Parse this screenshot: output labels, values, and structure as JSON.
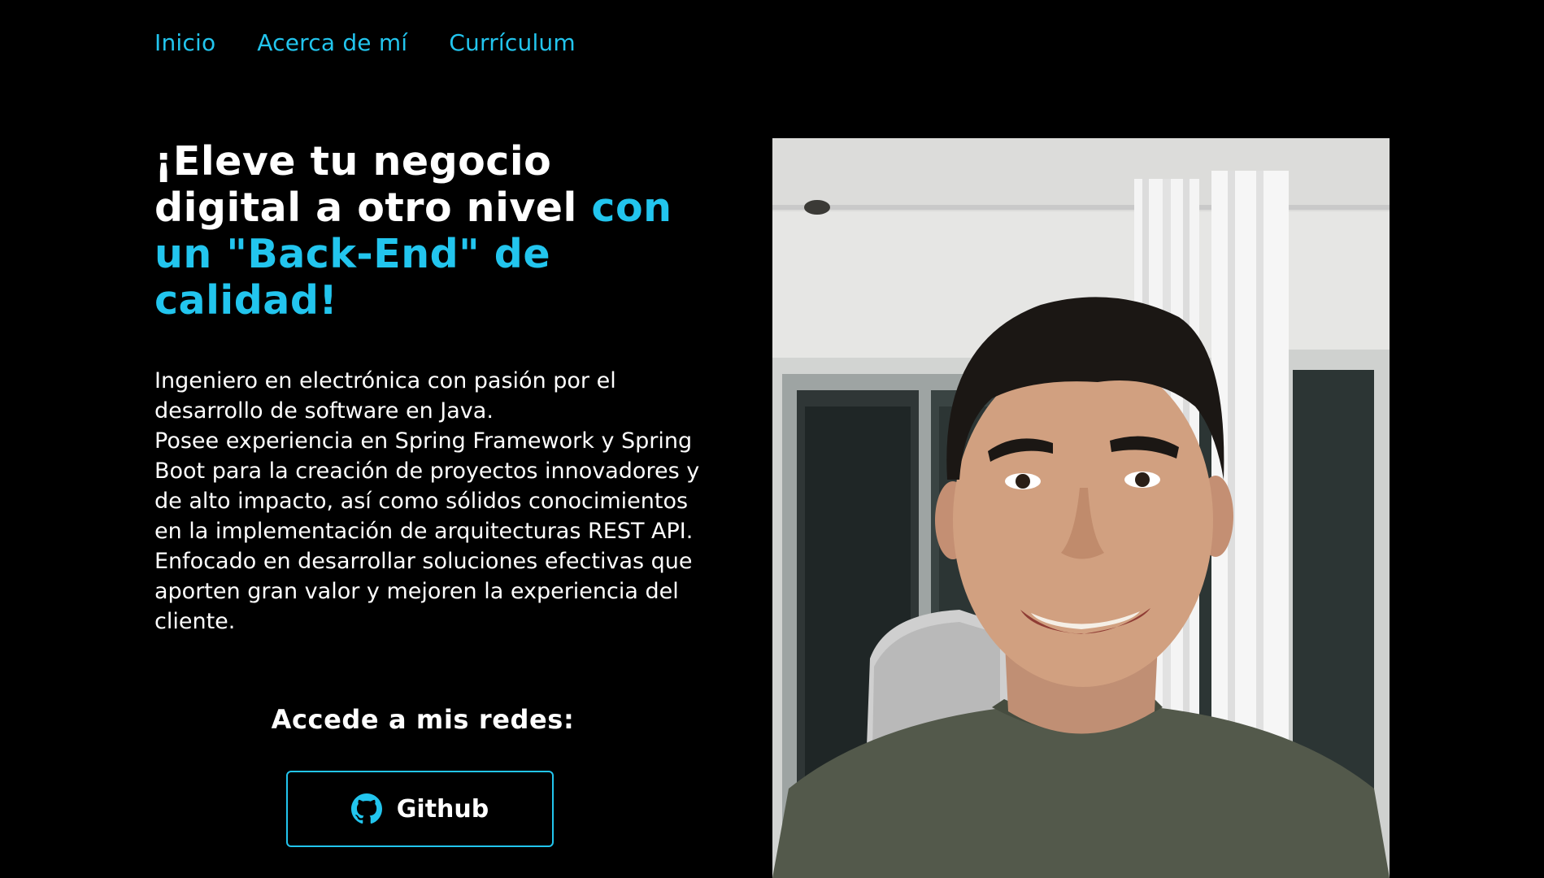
{
  "nav": {
    "items": [
      {
        "label": "Inicio"
      },
      {
        "label": "Acerca de mí"
      },
      {
        "label": "Currículum"
      }
    ]
  },
  "hero": {
    "headline_white": "¡Eleve tu negocio digital a otro nivel",
    "headline_accent": "con un \"Back-End\" de calidad!",
    "bio": [
      "Ingeniero en electrónica con pasión por el desarrollo de software en Java.",
      "Posee experiencia en Spring Framework y Spring Boot para la creación de proyectos innovadores y de alto impacto, así como sólidos conocimientos en la implementación de arquitecturas REST API.",
      "Enfocado en desarrollar soluciones efectivas que aporten gran valor y mejoren la experiencia del cliente."
    ]
  },
  "socials": {
    "title": "Accede a mis redes:",
    "github_label": "Github",
    "github_icon": "github-icon"
  },
  "photo": {
    "subject": "profile-photo"
  },
  "colors": {
    "background": "#000000",
    "accent": "#22c5ee",
    "text": "#ffffff"
  }
}
